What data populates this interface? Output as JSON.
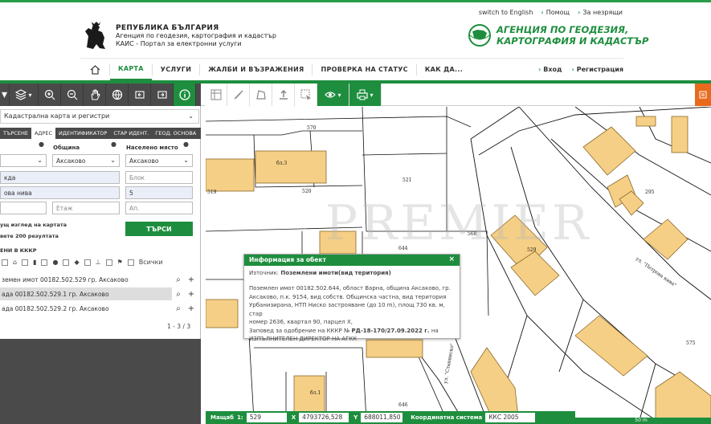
{
  "header": {
    "links": [
      "switch to English",
      "Помощ",
      "За незрящи"
    ],
    "org_line1": "РЕПУБЛИКА БЪЛГАРИЯ",
    "org_line2": "Агенция по геодезия, картография и кадастър",
    "org_line3": "КАИС - Портал за електронни услуги",
    "agency_line1": "АГЕНЦИЯ ПО ГЕОДЕЗИЯ,",
    "agency_line2": "КАРТОГРАФИЯ И КАДАСТЪР"
  },
  "nav": {
    "items": [
      "КАРТА",
      "УСЛУГИ",
      "ЖАЛБИ И ВЪЗРАЖЕНИЯ",
      "ПРОВЕРКА НА СТАТУС",
      "КАК ДА..."
    ],
    "login": "Вход",
    "register": "Регистрация"
  },
  "panel": {
    "layer": "Кадастрална карта и регистри",
    "tabs": [
      "ТЪРСЕНЕ",
      "АДРЕС",
      "ИДЕНТИФИКАТОР",
      "СТАР ИДЕНТ.",
      "ГЕОД. ОСНОВА"
    ],
    "label_obshtina": "Община",
    "label_naseleno": "Населено място",
    "sel_left": "",
    "sel_obshtina": "Аксаково",
    "sel_naseleno": "Аксаково",
    "street": "кда",
    "blok_ph": "Блок",
    "area": "ова нива",
    "number": "5",
    "etaj_ph": "Етаж",
    "ap_ph": "Ап.",
    "search_button": "ТЪРСИ",
    "note1": "ущ изглед на картата",
    "note2": "вете 200 резултата",
    "section_title": "ЕНИ В КККР",
    "all_label": "Всички",
    "results": [
      "земен имот 00182.502.529 гр. Аксаково",
      "ада 00182.502.529.1 гр. Аксаково",
      "ада 00182.502.529.2 гр. Аксаково"
    ],
    "pager": "1 - 3 / 3"
  },
  "popup": {
    "title": "Информация за обект",
    "source_label": "Източник:",
    "source_value": "Поземлени имоти(вид територия)",
    "line1": "Поземлен имот 00182.502.644, област Варна, община Аксаково, гр.",
    "line2": "Аксаково, п.к. 9154, вид собств. Общинска частна, вид територия",
    "line3": "Урбанизирана, НТП Ниско застрояване (до 10 m), площ 730 кв. м, стар",
    "line4": "номер 2636, квартал 90, парцел X,",
    "line5a": "Заповед за одобрение на КККР №",
    "line5b": "РД-18-170/27.09.2022 г.",
    "line5c": "на",
    "line6": "ИЗПЪЛНИТЕЛЕН ДИРЕКТОР НА АГКК"
  },
  "map_labels": {
    "p570": "570",
    "p521": "521",
    "p520": "520",
    "p644": "644",
    "p568": "568",
    "p529": "529",
    "p295": "295",
    "p575": "575",
    "p646": "646",
    "p519": "519",
    "street1": "ул. \"Петрова нива\"",
    "street2": "ул. \"Станинско\"",
    "b1": "бл.3",
    "b2": "бл.1"
  },
  "status": {
    "scale_label": "Мащаб",
    "scale_sep": "1:",
    "scale_value": "529",
    "x_label": "X",
    "x_value": "4793726,528",
    "y_label": "Y",
    "y_value": "688011,850",
    "coord_label": "Координатна система",
    "coord_value": "ККС 2005",
    "scalebar": "50 m"
  },
  "colors": {
    "accent": "#1e8e3e",
    "parcel": "#f6cf86",
    "orange": "#e86a1c",
    "panel_dark": "#4a4a4a"
  }
}
